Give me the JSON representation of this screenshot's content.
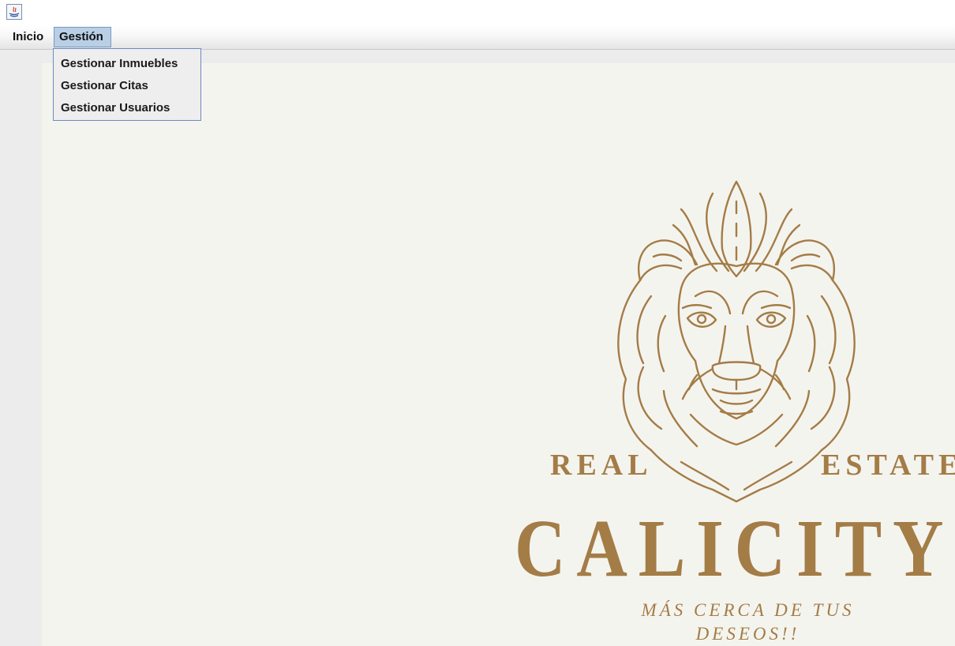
{
  "window": {
    "icon": "java-app-icon"
  },
  "menubar": {
    "items": [
      {
        "label": "Inicio"
      },
      {
        "label": "Gestión"
      }
    ]
  },
  "dropdown": {
    "items": [
      {
        "label": "Gestionar Inmuebles"
      },
      {
        "label": "Gestionar Citas"
      },
      {
        "label": "Gestionar Usuarios"
      }
    ]
  },
  "logo": {
    "icon": "lion-head-icon",
    "left_word": "REAL",
    "right_word": "ESTATE",
    "name": "CALICITY",
    "tagline": "MÁS CERCA DE TUS DESEOS!!",
    "color": "#a47c46"
  },
  "colors": {
    "selected_menu": "#b8cfe5",
    "dropdown_border": "#6b8bc2",
    "canvas_bg": "#f4f4ef"
  }
}
